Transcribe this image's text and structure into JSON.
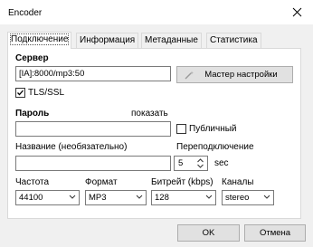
{
  "window": {
    "title": "Encoder"
  },
  "tabs": [
    {
      "label": "Подключение"
    },
    {
      "label": "Информация"
    },
    {
      "label": "Метаданные"
    },
    {
      "label": "Статистика"
    }
  ],
  "server": {
    "label": "Сервер",
    "value": "[IA]:8000/mp3:50",
    "wizard_button": "Мастер настройки",
    "tls_label": "TLS/SSL",
    "tls_checked": true
  },
  "password": {
    "label": "Пароль",
    "show_link": "показать",
    "value": "",
    "public_label": "Публичный",
    "public_checked": false
  },
  "name": {
    "label": "Название (необязательно)",
    "value": ""
  },
  "reconnect": {
    "label": "Переподключение",
    "value": "5",
    "unit": "sec"
  },
  "frequency": {
    "label": "Частота",
    "value": "44100"
  },
  "format": {
    "label": "Формат",
    "value": "MP3"
  },
  "bitrate": {
    "label": "Битрейт (kbps)",
    "value": "128"
  },
  "channels": {
    "label": "Каналы",
    "value": "stereo"
  },
  "buttons": {
    "ok": "OK",
    "cancel": "Отмена"
  }
}
